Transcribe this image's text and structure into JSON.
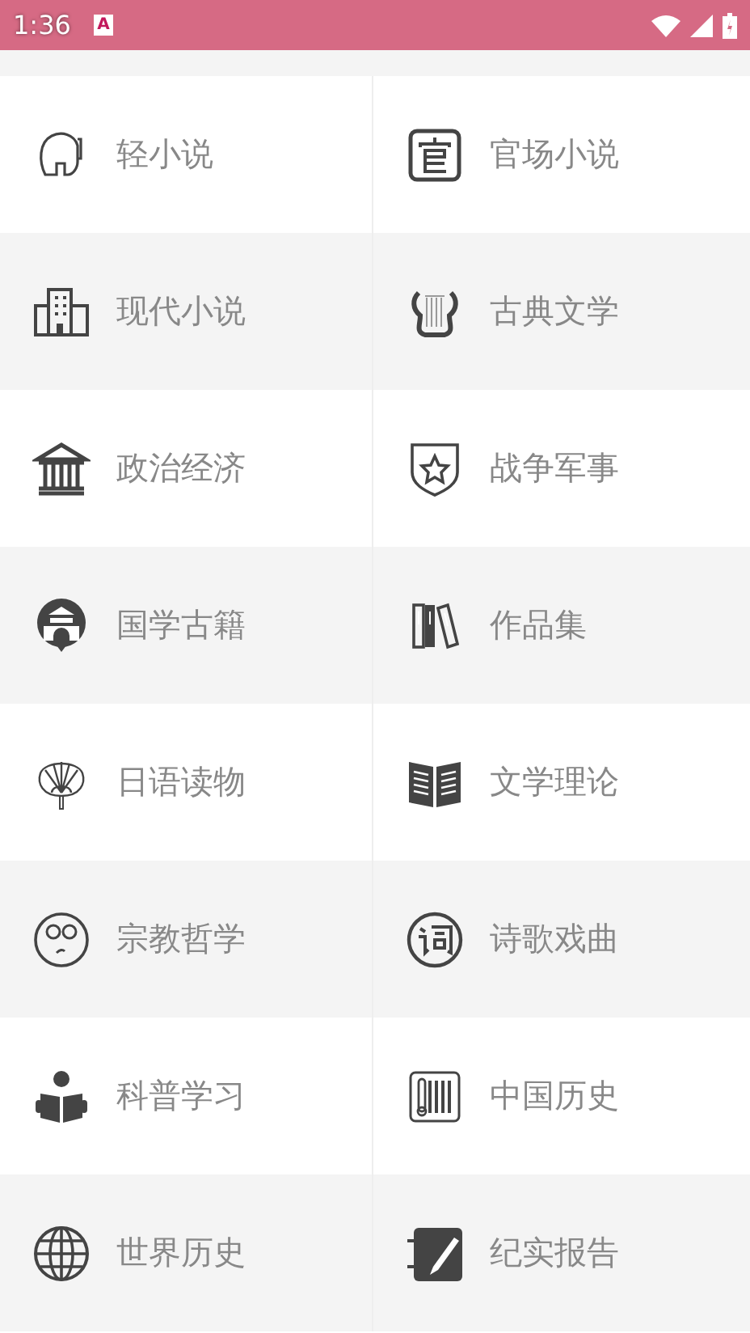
{
  "status_bar": {
    "time": "1:36",
    "notification": "A"
  },
  "categories": [
    {
      "label": "轻小说"
    },
    {
      "label": "官场小说"
    },
    {
      "label": "现代小说"
    },
    {
      "label": "古典文学"
    },
    {
      "label": "政治经济"
    },
    {
      "label": "战争军事"
    },
    {
      "label": "国学古籍"
    },
    {
      "label": "作品集"
    },
    {
      "label": "日语读物"
    },
    {
      "label": "文学理论"
    },
    {
      "label": "宗教哲学"
    },
    {
      "label": "诗歌戏曲"
    },
    {
      "label": "科普学习"
    },
    {
      "label": "中国历史"
    },
    {
      "label": "世界历史"
    },
    {
      "label": "纪实报告"
    }
  ]
}
